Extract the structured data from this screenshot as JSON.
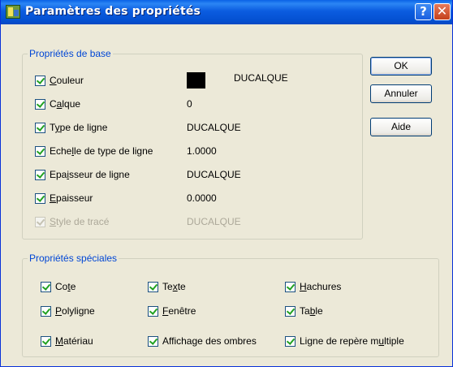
{
  "window": {
    "title": "Paramètres des propriétés",
    "help_glyph": "?",
    "close_glyph": "✕"
  },
  "basic": {
    "legend": "Propriétés de base",
    "rows": [
      {
        "pre": "",
        "u": "C",
        "post": "ouleur",
        "value": "DUCALQUE",
        "checked": true,
        "enabled": true
      },
      {
        "pre": "C",
        "u": "a",
        "post": "lque",
        "value": "0",
        "checked": true,
        "enabled": true
      },
      {
        "pre": "T",
        "u": "y",
        "post": "pe de ligne",
        "value": "DUCALQUE",
        "checked": true,
        "enabled": true
      },
      {
        "pre": "Eche",
        "u": "l",
        "post": "le de type de ligne",
        "value": "1.0000",
        "checked": true,
        "enabled": true
      },
      {
        "pre": "Epa",
        "u": "i",
        "post": "sseur de ligne",
        "value": "DUCALQUE",
        "checked": true,
        "enabled": true
      },
      {
        "pre": "",
        "u": "E",
        "post": "paisseur",
        "value": "0.0000",
        "checked": true,
        "enabled": true
      },
      {
        "pre": "",
        "u": "S",
        "post": "tyle de tracé",
        "value": "DUCALQUE",
        "checked": true,
        "enabled": false
      }
    ],
    "color_swatch": "#000000"
  },
  "special": {
    "legend": "Propriétés spéciales",
    "items": [
      {
        "pre": "Co",
        "u": "t",
        "post": "e",
        "checked": true
      },
      {
        "pre": "Te",
        "u": "x",
        "post": "te",
        "checked": true
      },
      {
        "pre": "",
        "u": "H",
        "post": "achures",
        "checked": true
      },
      {
        "pre": "",
        "u": "P",
        "post": "olyligne",
        "checked": true
      },
      {
        "pre": "",
        "u": "F",
        "post": "enêtre",
        "checked": true
      },
      {
        "pre": "Ta",
        "u": "b",
        "post": "le",
        "checked": true
      },
      {
        "pre": "",
        "u": "M",
        "post": "atériau",
        "checked": true
      },
      {
        "pre": "Affichage des ombres",
        "u": "",
        "post": "",
        "checked": true
      },
      {
        "pre": "Ligne de repère m",
        "u": "u",
        "post": "ltiple",
        "checked": true
      }
    ]
  },
  "buttons": {
    "ok": "OK",
    "cancel": "Annuler",
    "help": "Aide"
  },
  "colors": {
    "titlebar": "#0450d1",
    "dialog_bg": "#ece9d8",
    "groupbox_legend": "#0046d5",
    "check_mark": "#21a121",
    "disabled_text": "#aca899"
  }
}
